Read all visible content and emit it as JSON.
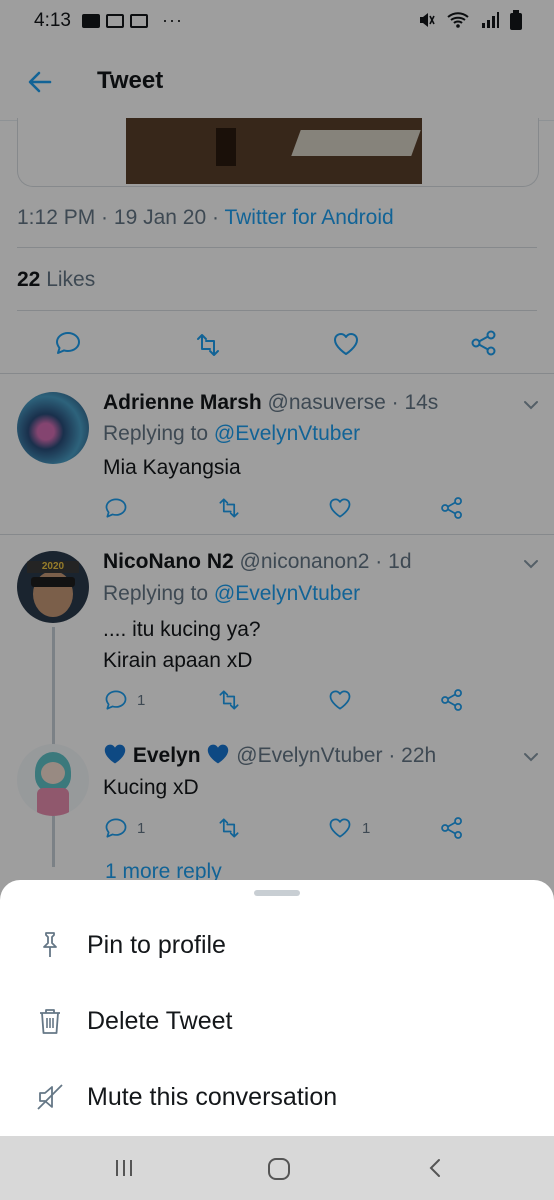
{
  "status_bar": {
    "time": "4:13",
    "more": "···"
  },
  "header": {
    "title": "Tweet"
  },
  "tweet": {
    "time": "1:12 PM",
    "date": "19 Jan 20",
    "source": "Twitter for Android",
    "likes_count": "22",
    "likes_label": "Likes"
  },
  "replies": [
    {
      "name": "Adrienne Marsh",
      "handle": "@nasuverse",
      "age": "14s",
      "replying_prefix": "Replying to",
      "replying_to": "@EvelynVtuber",
      "text": "Mia Kayangsia",
      "reply_count": "",
      "like_count": ""
    },
    {
      "name": "NicoNano N2",
      "handle": "@niconanon2",
      "age": "1d",
      "replying_prefix": "Replying to",
      "replying_to": "@EvelynVtuber",
      "text_line1": ".... itu kucing ya?",
      "text_line2": "Kirain apaan xD",
      "reply_count": "1",
      "like_count": "",
      "avatar_text": "2020"
    },
    {
      "name": "Evelyn",
      "handle": "@EvelynVtuber",
      "age": "22h",
      "text": "Kucing xD",
      "reply_count": "1",
      "like_count": "1"
    }
  ],
  "more_replies": "1 more reply",
  "sheet": {
    "items": [
      {
        "label": "Pin to profile",
        "icon": "pin-icon"
      },
      {
        "label": "Delete Tweet",
        "icon": "trash-icon"
      },
      {
        "label": "Mute this conversation",
        "icon": "mute-icon"
      }
    ]
  },
  "colors": {
    "accent": "#1da1f2",
    "secondary_text": "#657786",
    "heart_blue": "#1877d4"
  }
}
